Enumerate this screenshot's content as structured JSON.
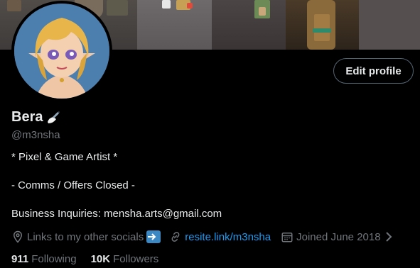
{
  "banner": {
    "panels": [
      "panel-1",
      "panel-2",
      "panel-3",
      "panel-4",
      "panel-5"
    ]
  },
  "profile": {
    "name": "Bera",
    "handle": "@m3nsha",
    "edit_label": "Edit profile",
    "bio": {
      "line1": "* Pixel & Game Artist *",
      "line2": "- Comms / Offers Closed -",
      "line3": "Business Inquiries: mensha.arts@gmail.com"
    },
    "meta": {
      "location": "Links to my other socials",
      "website": "resite.link/m3nsha",
      "joined": "Joined June 2018"
    },
    "stats": {
      "following_count": "911",
      "following_label": "Following",
      "followers_count": "10K",
      "followers_label": "Followers"
    }
  },
  "colors": {
    "accent": "#1d9bf0",
    "secondary_text": "#71767b",
    "primary_text": "#e7e9ea"
  }
}
